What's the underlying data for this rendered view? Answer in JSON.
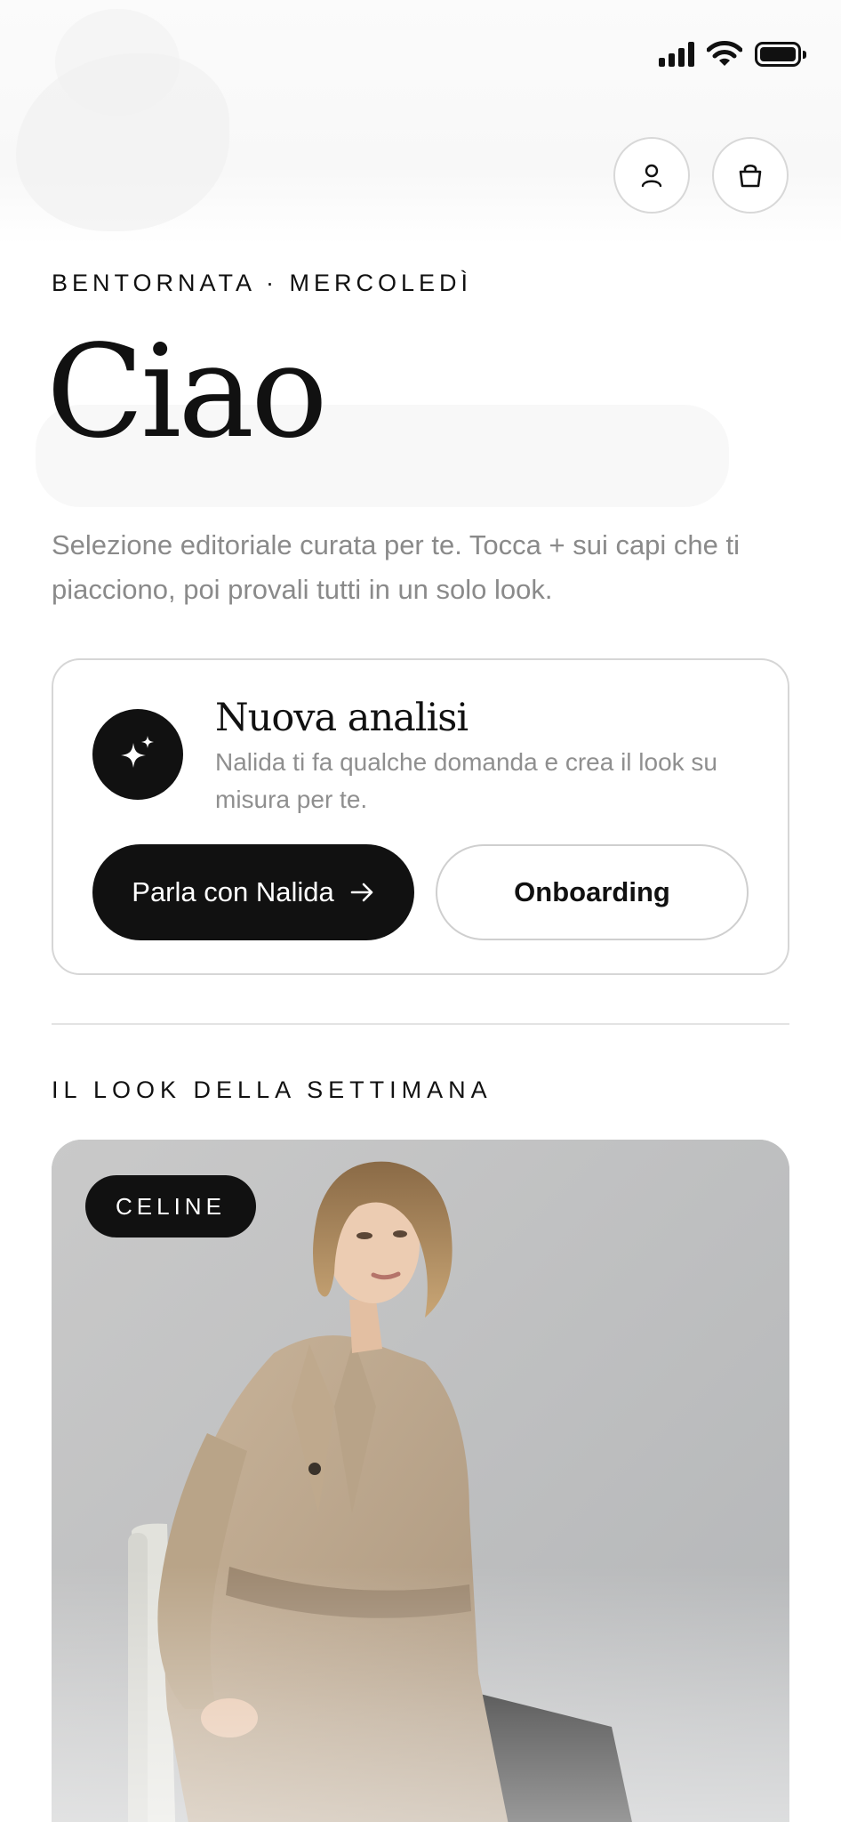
{
  "header": {
    "profile_icon": "person-icon",
    "bag_icon": "shopping-bag-icon"
  },
  "greeting": {
    "kicker": "BENTORNATA · MERCOLEDÌ",
    "title": "Ciao",
    "lead": "Selezione editoriale curata per te. Tocca + sui capi che ti piacciono, poi provali tutti in un solo look."
  },
  "analysis_card": {
    "icon": "sparkles-icon",
    "title": "Nuova analisi",
    "description": "Nalida ti fa qualche domanda e crea il look su misura per te.",
    "primary_label": "Parla con Nalida",
    "secondary_label": "Onboarding"
  },
  "weekly_look": {
    "section_title": "IL LOOK DELLA SETTIMANA",
    "brand_badge": "CELINE"
  }
}
